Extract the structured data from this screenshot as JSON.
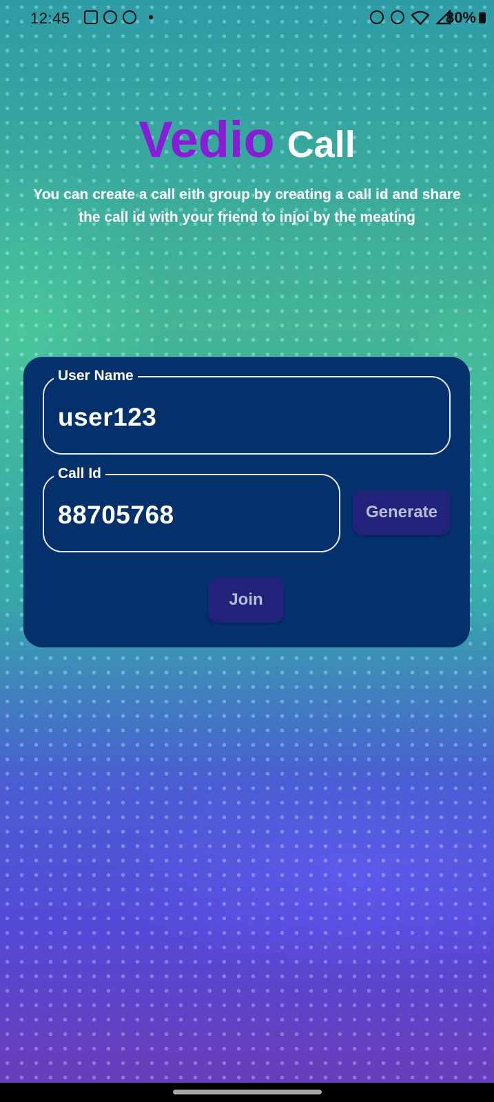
{
  "status_bar": {
    "time": "12:45",
    "battery": "80%",
    "left_icons": [
      "gallery-icon",
      "screen-record-icon",
      "chat-icon"
    ],
    "right_icons": [
      "alarm-icon",
      "data-saver-icon",
      "wifi-icon",
      "signal-icon"
    ]
  },
  "header": {
    "title_part1": "Vedio",
    "title_part2": "Call",
    "title_colors": {
      "vedio": "#8a1bd6",
      "call": "#ffffff"
    },
    "subtitle": "You can create a call eith group by creating a call id and share the call id with your friend to injoi by the meating"
  },
  "form": {
    "username": {
      "label": "User Name",
      "value": "user123"
    },
    "call_id": {
      "label": "Call Id",
      "value": "88705768"
    },
    "generate_label": "Generate",
    "join_label": "Join"
  },
  "colors": {
    "card_background": "#04306c",
    "button_background": "#21237a",
    "button_text": "#b9bdd3"
  }
}
